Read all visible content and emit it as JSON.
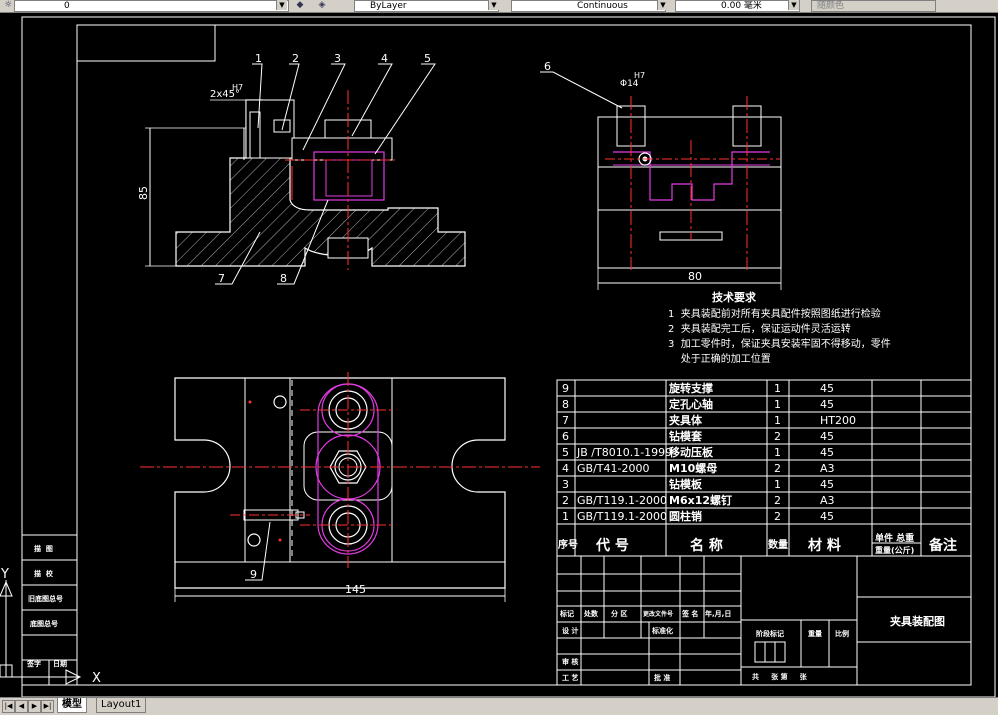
{
  "toolbar": {
    "layer_value": "0",
    "color_value": "ByLayer",
    "linetype_value": "Continuous",
    "lineweight_value": "0.00 毫米",
    "plotstyle_value": "随颜色"
  },
  "tabs": [
    "模型",
    "Layout1"
  ],
  "balloons": [
    "1",
    "2",
    "3",
    "4",
    "5",
    "6",
    "7",
    "8",
    "9"
  ],
  "dimensions": {
    "chamfer": "2x45°",
    "fit_h7_left": "H7",
    "fit_h7_right": "H7",
    "dia_right": "Φ14",
    "height_left": "85",
    "width_right": "80",
    "width_bottom": "145"
  },
  "tech": {
    "title": "技术要求",
    "items": [
      "1  夹具装配前对所有夹具配件按照图纸进行检验",
      "2  夹具装配完工后，保证运动件灵活运转",
      "3  加工零件时，保证夹具安装牢固不得移动，零件",
      "    处于正确的加工位置"
    ]
  },
  "bom": [
    {
      "no": "9",
      "code": "",
      "name": "旋转支撑",
      "qty": "1",
      "mat": "45"
    },
    {
      "no": "8",
      "code": "",
      "name": "定孔心轴",
      "qty": "1",
      "mat": "45"
    },
    {
      "no": "7",
      "code": "",
      "name": "夹具体",
      "qty": "1",
      "mat": "HT200"
    },
    {
      "no": "6",
      "code": "",
      "name": "钻模套",
      "qty": "2",
      "mat": "45"
    },
    {
      "no": "5",
      "code": "JB /T8010.1-1999",
      "name": "移动压板",
      "qty": "1",
      "mat": "45"
    },
    {
      "no": "4",
      "code": "GB/T41-2000",
      "name": "M10螺母",
      "qty": "2",
      "mat": "A3"
    },
    {
      "no": "3",
      "code": "",
      "name": "钻模板",
      "qty": "1",
      "mat": "45"
    },
    {
      "no": "2",
      "code": "GB/T119.1-2000",
      "name": "M6x12螺钉",
      "qty": "2",
      "mat": "A3"
    },
    {
      "no": "1",
      "code": "GB/T119.1-2000",
      "name": "圆柱销",
      "qty": "2",
      "mat": "45"
    }
  ],
  "bom_header": {
    "no": "序号",
    "code": "代 号",
    "name": "名 称",
    "qty": "数量",
    "mat": "材 料",
    "weight_top": "单件 总重",
    "weight_bottom": "重量(公斤)",
    "remark": "备注"
  },
  "titleblock": {
    "drawing_title": "夹具装配图",
    "row_labels": [
      "标记",
      "处数",
      "分 区",
      "更改文件号",
      "签 名",
      "年,月,日"
    ],
    "design": "设 计",
    "standard": "标准化",
    "stage": "阶段标记",
    "weight": "重量",
    "scale": "比例",
    "review": "审 核",
    "process": "工 艺",
    "approve": "批 准",
    "sheet_total": "共     张 第     张"
  },
  "side_table": [
    "描  图",
    "描  校",
    "旧底图总号",
    "底图总号",
    "签字",
    "日期"
  ],
  "ucs_labels": {
    "x": "X",
    "y": "Y"
  }
}
